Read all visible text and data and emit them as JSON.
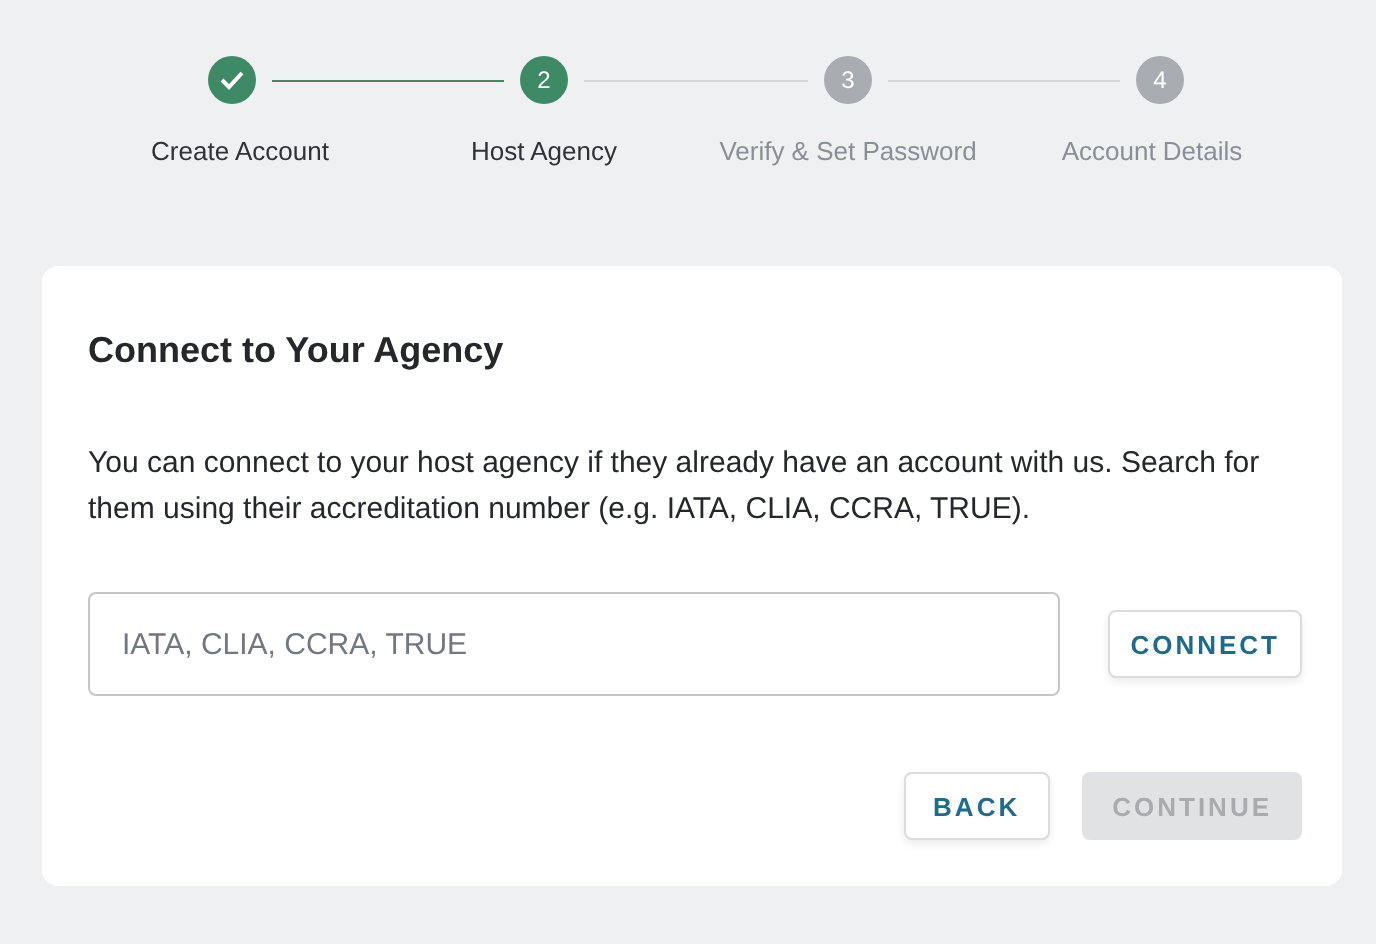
{
  "steps": [
    {
      "label": "Create Account",
      "completed": true,
      "selected": false
    },
    {
      "label": "Host Agency",
      "completed": false,
      "selected": true,
      "number": "2"
    },
    {
      "label": "Verify & Set Password",
      "completed": false,
      "selected": false,
      "number": "3"
    },
    {
      "label": "Account Details",
      "completed": false,
      "selected": false,
      "number": "4"
    }
  ],
  "card": {
    "title": "Connect to Your Agency",
    "description": "You can connect to your host agency if they already have an account with us. Search for them using their accreditation number (e.g. IATA, CLIA, CCRA, TRUE).",
    "search": {
      "placeholder": "IATA, CLIA, CCRA, TRUE"
    },
    "connect_button": {
      "label": "CONNECT",
      "disabled": false
    },
    "buttons": [
      {
        "label": "BACK",
        "disabled": false
      },
      {
        "label": "CONTINUE",
        "disabled": true
      }
    ]
  }
}
